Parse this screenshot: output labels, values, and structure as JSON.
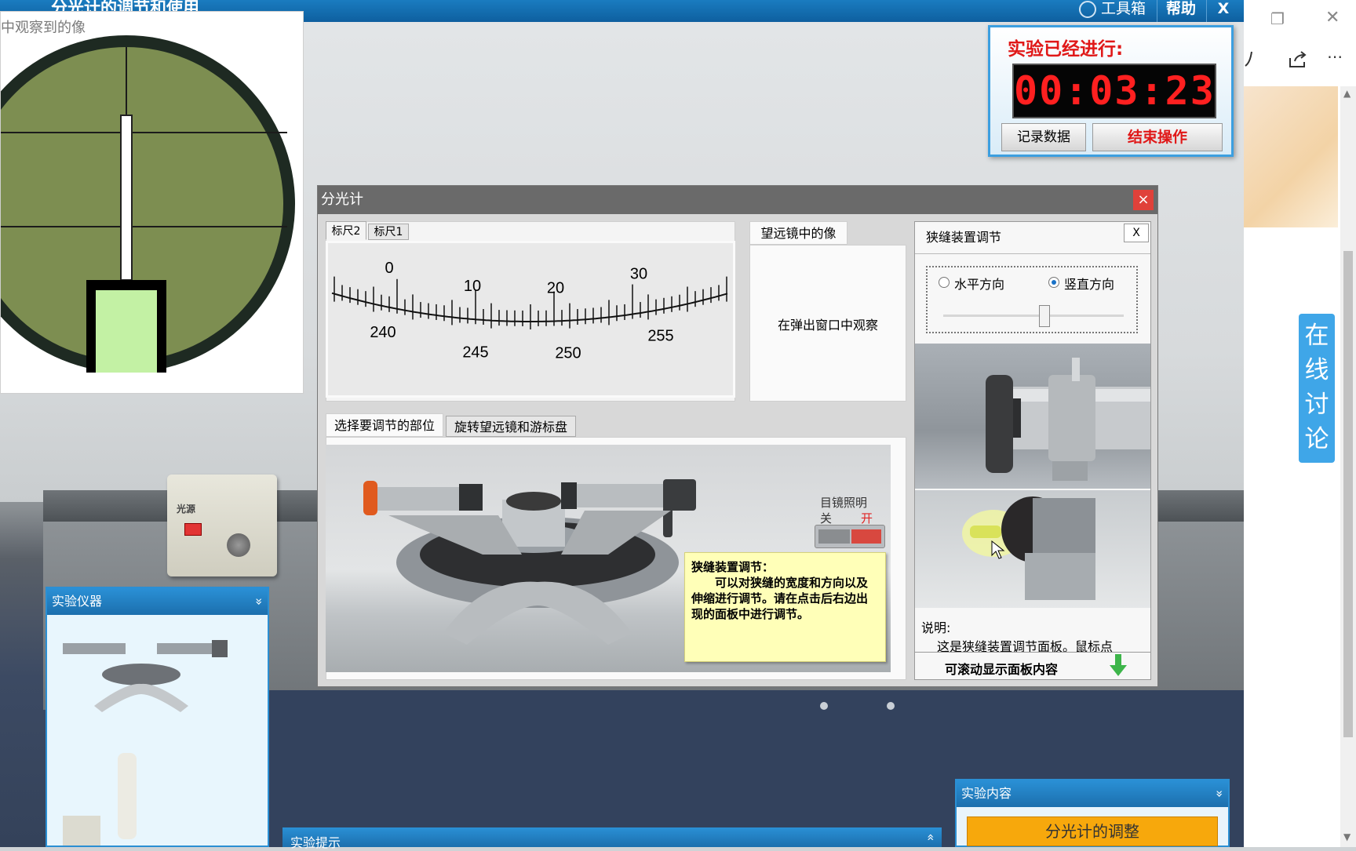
{
  "topbar": {
    "title": "分光计的调节和使用",
    "toolbox": "工具箱",
    "help": "帮助",
    "close": "X"
  },
  "browser": {
    "restore_icon": "restore-icon",
    "close_glyph": "✕",
    "discuss": [
      "在",
      "线",
      "讨",
      "论"
    ]
  },
  "observation": {
    "caption": "中观察到的像"
  },
  "timer": {
    "label": "实验已经进行:",
    "time": "00:03:23",
    "record_btn": "记录数据",
    "end_btn": "结束操作"
  },
  "dialog": {
    "title": "分光计",
    "close": "×",
    "scale_tabs": [
      "标尺2",
      "标尺1"
    ],
    "scale": {
      "vernier_labels": [
        "0",
        "10",
        "20",
        "30"
      ],
      "main_labels": [
        "240",
        "245",
        "250",
        "255"
      ]
    },
    "telescope_tab": "望远镜中的像",
    "telescope_text": "在弹出窗口中观察",
    "adjust_tabs": [
      "选择要调节的部位",
      "旋转望远镜和游标盘"
    ],
    "lamp": {
      "label": "目镜照明",
      "off": "关",
      "on": "开"
    },
    "note": {
      "title": "狭缝装置调节：",
      "body": "可以对狭缝的宽度和方向以及伸缩进行调节。请在点击后右边出现的面板中进行调节。"
    },
    "slit": {
      "title": "狭缝装置调节",
      "close": "X",
      "horizontal": "水平方向",
      "vertical": "竖直方向",
      "selected": "vertical",
      "desc_label": "说明:",
      "desc_text": "这是狭缝装置调节面板。鼠标点",
      "scroll_hint": "可滚动显示面板内容"
    }
  },
  "instruments": {
    "title": "实验仪器",
    "collapse": "»"
  },
  "content": {
    "title": "实验内容",
    "item": "分光计的调整"
  },
  "hints": {
    "title": "实验提示"
  },
  "lightsource": {
    "label": "光源"
  },
  "colors": {
    "accent": "#1c6fad",
    "timer_red": "#ff2020",
    "orange": "#f7a80c"
  }
}
